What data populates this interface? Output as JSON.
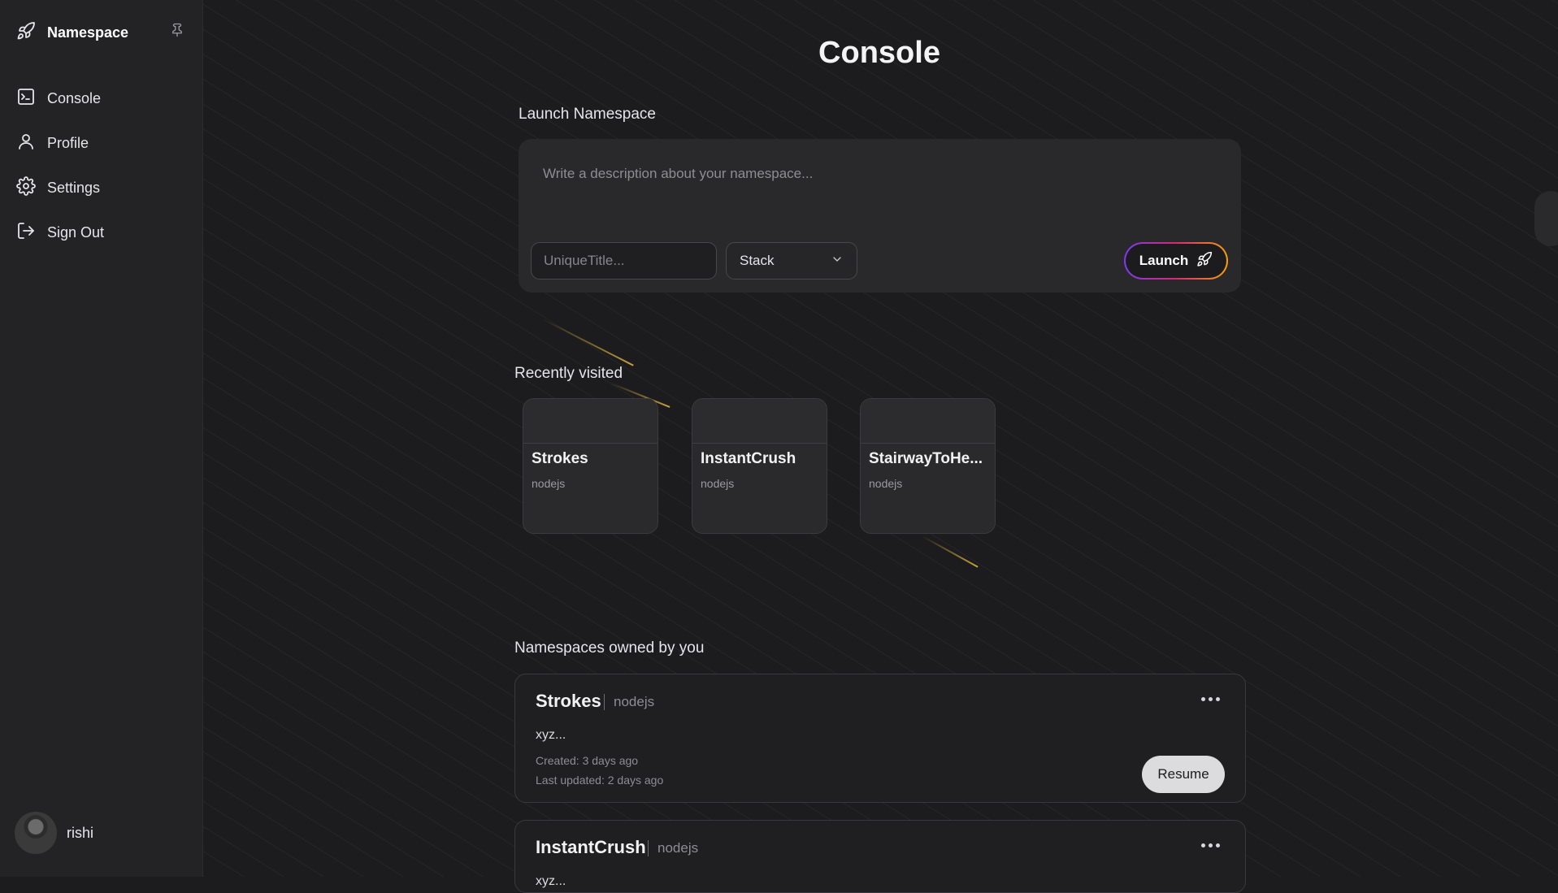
{
  "sidebar": {
    "brand": "Namespace",
    "items": [
      {
        "label": "Console",
        "icon": "terminal-icon"
      },
      {
        "label": "Profile",
        "icon": "user-icon"
      },
      {
        "label": "Settings",
        "icon": "gear-icon"
      },
      {
        "label": "Sign Out",
        "icon": "sign-out-icon"
      }
    ],
    "user": {
      "name": "rishi"
    }
  },
  "main": {
    "title": "Console",
    "launch": {
      "section_label": "Launch Namespace",
      "description_placeholder": "Write a description about your namespace...",
      "title_placeholder": "UniqueTitle...",
      "stack_label": "Stack",
      "launch_label": "Launch"
    },
    "recent": {
      "section_label": "Recently visited",
      "cards": [
        {
          "title": "Strokes",
          "stack": "nodejs"
        },
        {
          "title": "InstantCrush",
          "stack": "nodejs"
        },
        {
          "title": "StairwayToHe...",
          "stack": "nodejs"
        }
      ]
    },
    "owned": {
      "section_label": "Namespaces owned by you",
      "items": [
        {
          "name": "Strokes",
          "stack": "nodejs",
          "description": "xyz...",
          "created": "Created: 3 days ago",
          "updated": "Last updated: 2 days ago",
          "action": "Resume"
        },
        {
          "name": "InstantCrush",
          "stack": "nodejs",
          "description": "xyz...",
          "created": "",
          "updated": "",
          "action": ""
        }
      ]
    }
  },
  "colors": {
    "background": "#1c1c1e",
    "sidebar": "#232325",
    "launch_gradient": [
      "#7c3aed",
      "#db2777",
      "#f59e0b"
    ]
  }
}
